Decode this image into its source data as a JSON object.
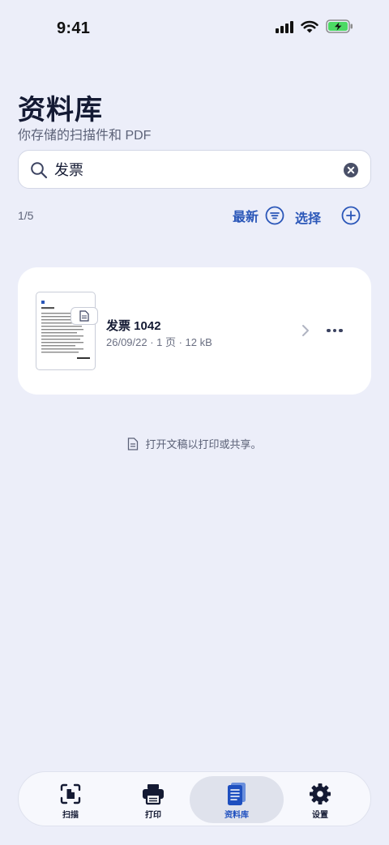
{
  "status_bar": {
    "time": "9:41"
  },
  "header": {
    "title": "资料库",
    "subtitle": "你存储的扫描件和 PDF"
  },
  "search": {
    "value": "发票",
    "placeholder": ""
  },
  "toolbar": {
    "count": "1/5",
    "sort_label": "最新",
    "select_label": "选择"
  },
  "documents": [
    {
      "name": "发票 1042",
      "meta": "26/09/22 · 1 页 · 12 kB",
      "thumb_title": "发票 1042"
    }
  ],
  "hint": {
    "text": "打开文稿以打印或共享。"
  },
  "tab_bar": {
    "items": [
      {
        "label": "扫描",
        "icon": "scan-icon"
      },
      {
        "label": "打印",
        "icon": "printer-icon"
      },
      {
        "label": "资料库",
        "icon": "library-icon",
        "active": true
      },
      {
        "label": "设置",
        "icon": "gear-icon"
      }
    ]
  },
  "colors": {
    "accent": "#2a56b8",
    "background": "#eceef9",
    "battery": "#4cd964"
  }
}
